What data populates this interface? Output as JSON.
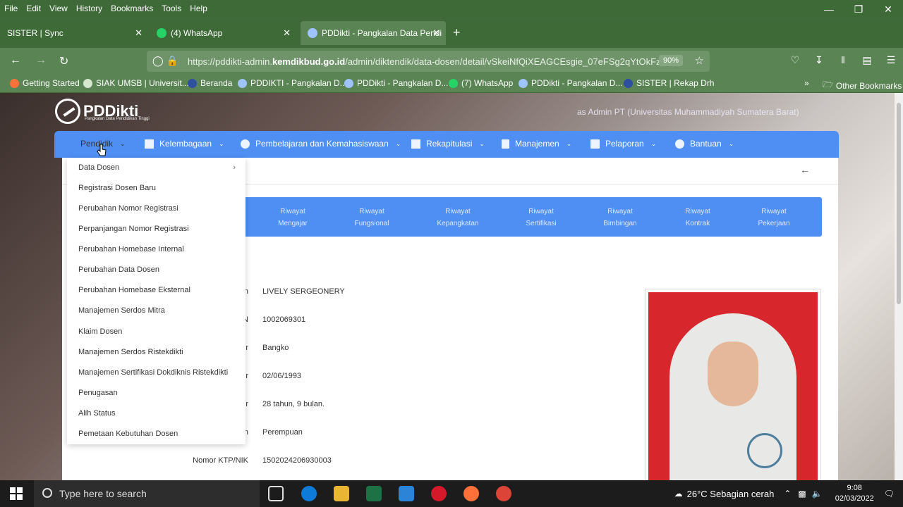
{
  "browser": {
    "menu": [
      "File",
      "Edit",
      "View",
      "History",
      "Bookmarks",
      "Tools",
      "Help"
    ],
    "tabs": [
      {
        "title": "SISTER | Sync",
        "active": false
      },
      {
        "title": "(4) WhatsApp",
        "active": false
      },
      {
        "title": "PDDikti - Pangkalan Data Pendi",
        "active": true
      }
    ],
    "url": {
      "prefix": "https://pddikti-admin.",
      "host": "kemdikbud.go.id",
      "path": "/admin/diktendik/data-dosen/detail/vSkeiNfQiXEAGCEsgie_07eFSg2qYtOkFz"
    },
    "zoom": "90%",
    "bookmarks": [
      "Getting Started",
      "SIAK UMSB | Universit...",
      "Beranda",
      "PDDIKTI - Pangkalan D...",
      "PDDikti - Pangkalan D...",
      "(7) WhatsApp",
      "PDDikti - Pangkalan D...",
      "SISTER | Rekap Drh",
      "Other Bookmarks"
    ]
  },
  "app": {
    "logo_text": "PDDikti",
    "logo_sub": "Pangkalan Data Pendidikan Tinggi",
    "login_info": "as Admin PT (Universitas Muhammadiyah Sumatera Barat)",
    "nav": [
      {
        "label": "Pendidik",
        "active": true
      },
      {
        "label": "Kelembagaan"
      },
      {
        "label": "Pembelajaran dan Kemahasiswaan"
      },
      {
        "label": "Rekapitulasi"
      },
      {
        "label": "Manajemen"
      },
      {
        "label": "Pelaporan"
      },
      {
        "label": "Bantuan"
      }
    ],
    "riwayat_tabs": [
      [
        "Riwayat",
        "Mengajar"
      ],
      [
        "Riwayat",
        "Fungsional"
      ],
      [
        "Riwayat",
        "Kepangkatan"
      ],
      [
        "Riwayat",
        "Sertifikasi"
      ],
      [
        "Riwayat",
        "Bimbingan"
      ],
      [
        "Riwayat",
        "Kontrak"
      ],
      [
        "Riwayat",
        "Pekerjaan"
      ]
    ],
    "profile": {
      "label_suffixes": [
        "n",
        "N",
        "r",
        "r",
        "r",
        "n"
      ],
      "values": [
        "LIVELY SERGEONERY",
        "1002069301",
        "Bangko",
        "02/06/1993",
        "28 tahun, 9 bulan.",
        "Perempuan"
      ],
      "ktp_label": "Nomor KTP/NIK",
      "ktp_value": "1502024206930003"
    },
    "dropdown": [
      "Data Dosen",
      "Registrasi Dosen Baru",
      "Perubahan Nomor Registrasi",
      "Perpanjangan Nomor Registrasi",
      "Perubahan Homebase Internal",
      "Perubahan Data Dosen",
      "Perubahan Homebase Eksternal",
      "Manajemen Serdos Mitra",
      "Klaim Dosen",
      "Manajemen Serdos Ristekdikti",
      "Manajemen Sertifikasi Dokdiknis Ristekdikti",
      "Penugasan",
      "Alih Status",
      "Pemetaan Kebutuhan Dosen"
    ]
  },
  "taskbar": {
    "search_placeholder": "Type here to search",
    "weather": "26°C  Sebagian cerah",
    "time": "9:08",
    "date": "02/03/2022"
  },
  "colors": {
    "chrome_green": "#3e6a38",
    "nav_blue": "#4f8ff4",
    "highlight_yellow": "#f4ef1a"
  }
}
